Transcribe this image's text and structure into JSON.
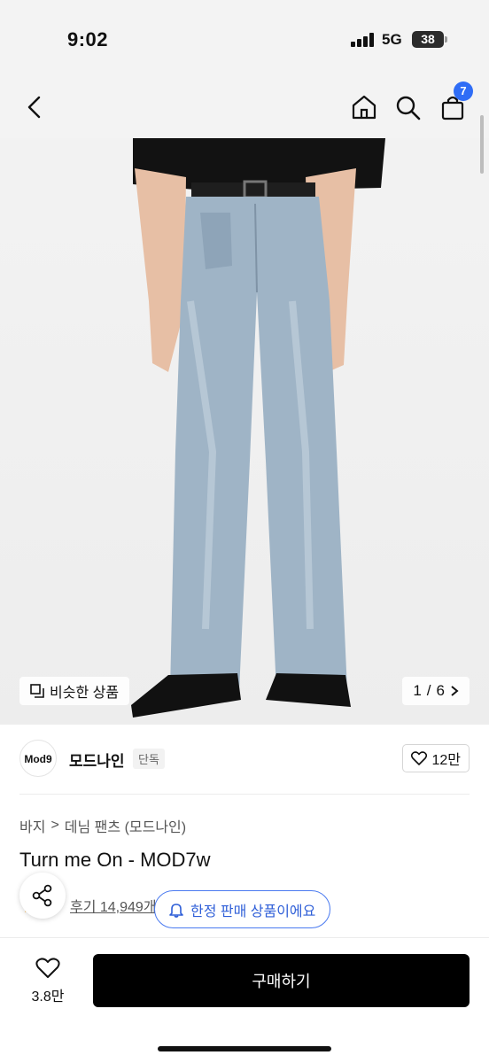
{
  "status": {
    "time": "9:02",
    "network": "5G",
    "battery": "38"
  },
  "nav": {
    "cart_count": "7"
  },
  "gallery": {
    "similar_label": "비슷한 상품",
    "page_current": "1",
    "page_total": "6",
    "page_separator": "/"
  },
  "brand": {
    "logo_text": "Mod9",
    "name": "모드나인",
    "tag": "단독",
    "likes": "12만"
  },
  "breadcrumb": {
    "category": "바지",
    "separator": ">",
    "subcategory": "데님 팬츠 (모드나인)"
  },
  "product": {
    "title": "Turn me On - MOD7w",
    "reviews": "후기 14,949개"
  },
  "limited_notice": "한정 판매 상품이에요",
  "bottom": {
    "wish_count": "3.8만",
    "buy_label": "구매하기"
  },
  "colors": {
    "accent": "#2f6df6",
    "buy_bg": "#000000",
    "denim": "#9fb4c6",
    "shirt": "#111111"
  }
}
